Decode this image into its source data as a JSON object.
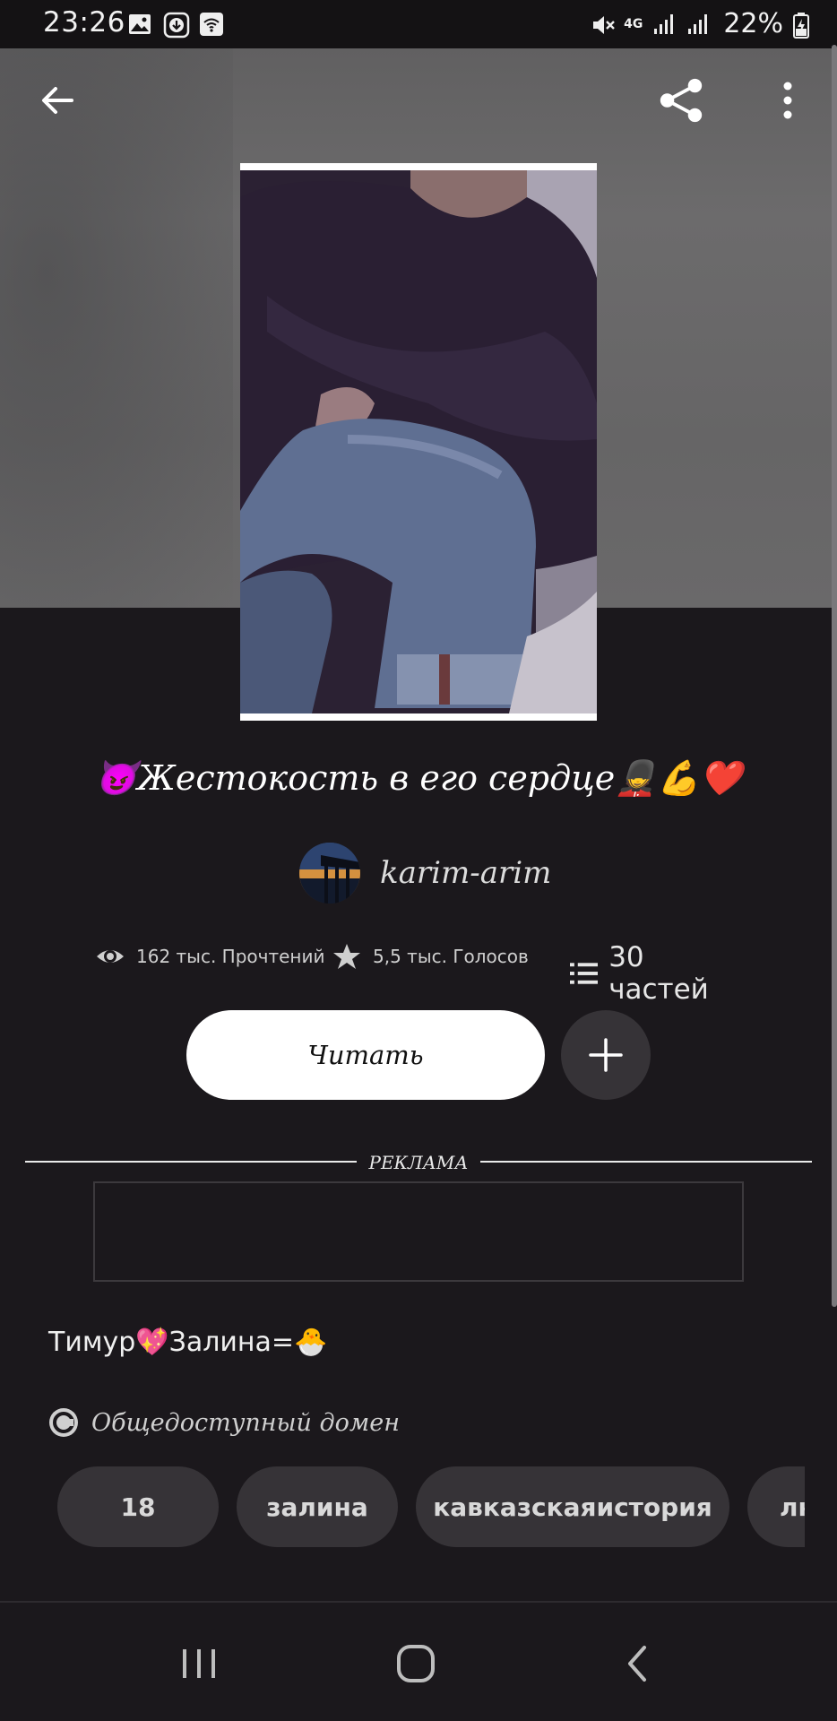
{
  "status_bar": {
    "time": "23:26",
    "network": "4G",
    "battery": "22%"
  },
  "top_bar": {
    "back_icon": "arrow-left-icon",
    "share_icon": "share-icon",
    "more_icon": "more-vertical-icon"
  },
  "story": {
    "title_prefix_emoji": "😈",
    "title": "Жестокость в его сердце",
    "title_suffix_emoji": "💂💪❤️",
    "author": "karim-arim",
    "stats": {
      "reads": "162 тыс. Прочтений",
      "votes": "5,5 тыс. Голосов",
      "parts": "30 частей"
    },
    "read_button": "Читать",
    "description_part1": "Тимур",
    "description_emoji1": "💖",
    "description_part2": "Залина=",
    "description_emoji2": "🐣",
    "license": "Общедоступный домен",
    "tags": [
      "18",
      "залина",
      "кавказскаяистория",
      "лю"
    ]
  },
  "ad": {
    "label": "РЕКЛАМА"
  },
  "colors": {
    "background": "#1b181c",
    "hero": "#686768",
    "button_dark": "#363337",
    "button_light": "#ffffff"
  }
}
